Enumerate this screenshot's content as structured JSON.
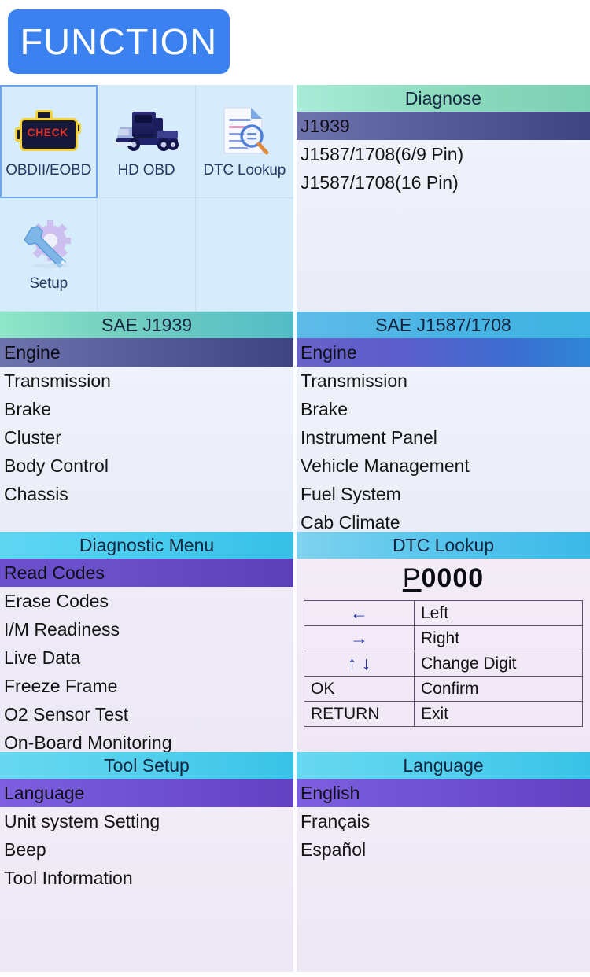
{
  "brand": {
    "logo_text": "FUNCTION",
    "logo_color": "#3b82f0"
  },
  "home_menu": {
    "items": [
      {
        "label": "OBDII/EOBD",
        "icon": "check-engine-icon",
        "selected": true
      },
      {
        "label": "HD OBD",
        "icon": "truck-icon",
        "selected": false
      },
      {
        "label": "DTC Lookup",
        "icon": "document-search-icon",
        "selected": false
      },
      {
        "label": "Setup",
        "icon": "gear-wrench-icon",
        "selected": false
      }
    ],
    "check_engine_word": "CHECK"
  },
  "diagnose": {
    "title": "Diagnose",
    "items": [
      {
        "label": "J1939",
        "selected": true
      },
      {
        "label": "J1587/1708(6/9 Pin)",
        "selected": false
      },
      {
        "label": "J1587/1708(16 Pin)",
        "selected": false
      }
    ]
  },
  "sae_j1939": {
    "title": "SAE J1939",
    "items": [
      {
        "label": "Engine",
        "selected": true
      },
      {
        "label": "Transmission",
        "selected": false
      },
      {
        "label": "Brake",
        "selected": false
      },
      {
        "label": "Cluster",
        "selected": false
      },
      {
        "label": "Body Control",
        "selected": false
      },
      {
        "label": "Chassis",
        "selected": false
      }
    ]
  },
  "sae_j1587": {
    "title": "SAE J1587/1708",
    "items": [
      {
        "label": "Engine",
        "selected": true
      },
      {
        "label": "Transmission",
        "selected": false
      },
      {
        "label": "Brake",
        "selected": false
      },
      {
        "label": "Instrument Panel",
        "selected": false
      },
      {
        "label": "Vehicle Management",
        "selected": false
      },
      {
        "label": "Fuel System",
        "selected": false
      },
      {
        "label": "Cab Climate",
        "selected": false
      }
    ]
  },
  "diagnostic_menu": {
    "title": "Diagnostic Menu",
    "items": [
      {
        "label": "Read Codes",
        "selected": true
      },
      {
        "label": "Erase Codes",
        "selected": false
      },
      {
        "label": "I/M Readiness",
        "selected": false
      },
      {
        "label": "Live Data",
        "selected": false
      },
      {
        "label": "Freeze Frame",
        "selected": false
      },
      {
        "label": "O2 Sensor Test",
        "selected": false
      },
      {
        "label": "On-Board Monitoring",
        "selected": false
      }
    ]
  },
  "dtc_lookup": {
    "title": "DTC Lookup",
    "code_cursor": "P",
    "code_digits": "0000",
    "rows": [
      {
        "key": "left-arrow-icon",
        "key_text": "←",
        "action": "Left"
      },
      {
        "key": "right-arrow-icon",
        "key_text": "→",
        "action": "Right"
      },
      {
        "key": "up-down-arrow-icon",
        "key_text": "↑ ↓",
        "action": "Change Digit"
      },
      {
        "key": "ok-key",
        "key_text": "OK",
        "action": "Confirm"
      },
      {
        "key": "return-key",
        "key_text": "RETURN",
        "action": "Exit"
      }
    ]
  },
  "tool_setup": {
    "title": "Tool Setup",
    "items": [
      {
        "label": "Language",
        "selected": true
      },
      {
        "label": "Unit system Setting",
        "selected": false
      },
      {
        "label": "Beep",
        "selected": false
      },
      {
        "label": "Tool Information",
        "selected": false
      }
    ]
  },
  "language": {
    "title": "Language",
    "items": [
      {
        "label": "English",
        "selected": true
      },
      {
        "label": "Français",
        "selected": false
      },
      {
        "label": "Español",
        "selected": false
      }
    ]
  }
}
